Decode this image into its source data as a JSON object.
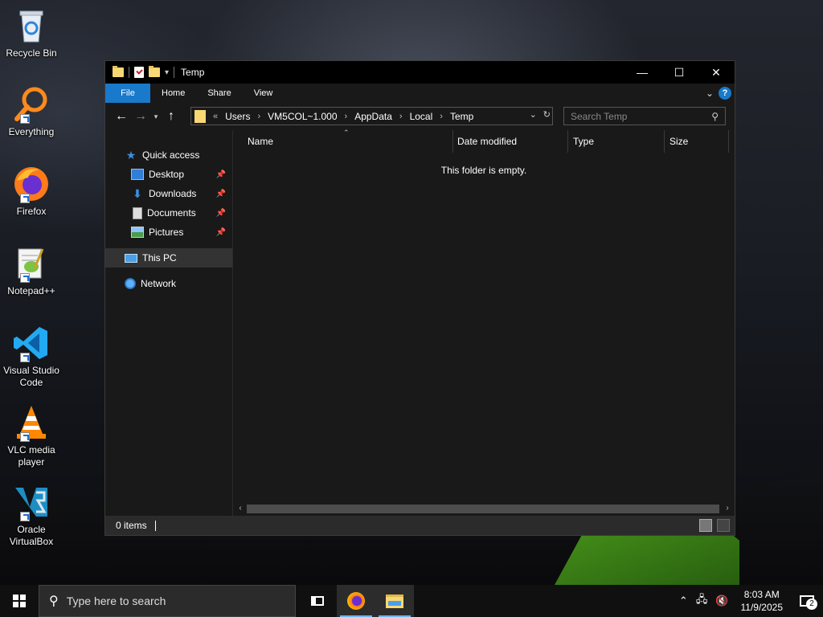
{
  "desktop": {
    "icons": [
      {
        "label": "Recycle Bin",
        "icon": "recycle-bin-icon"
      },
      {
        "label": "Everything",
        "icon": "everything-search-icon"
      },
      {
        "label": "Firefox",
        "icon": "firefox-icon"
      },
      {
        "label": "Notepad++",
        "icon": "notepadpp-icon"
      },
      {
        "label": "Visual Studio Code",
        "icon": "vscode-icon"
      },
      {
        "label": "VLC media player",
        "icon": "vlc-icon"
      },
      {
        "label": "Oracle VirtualBox",
        "icon": "virtualbox-icon"
      }
    ]
  },
  "window": {
    "title": "Temp",
    "ribbon_tabs": [
      "File",
      "Home",
      "Share",
      "View"
    ],
    "address": {
      "overflow": "«",
      "crumbs": [
        "Users",
        "VM5COL~1.000",
        "AppData",
        "Local",
        "Temp"
      ]
    },
    "search_placeholder": "Search Temp",
    "nav": {
      "quick_access": "Quick access",
      "items": [
        "Desktop",
        "Downloads",
        "Documents",
        "Pictures"
      ],
      "this_pc": "This PC",
      "network": "Network"
    },
    "columns": [
      "Name",
      "Date modified",
      "Type",
      "Size"
    ],
    "empty_message": "This folder is empty.",
    "status": "0 items"
  },
  "taskbar": {
    "search_placeholder": "Type here to search",
    "time": "8:03 AM",
    "date": "11/9/2025",
    "notification_count": "2"
  },
  "colors": {
    "accent": "#1979ca",
    "window_bg": "#191919",
    "titlebar_bg": "#000000",
    "folder": "#f8d775"
  }
}
